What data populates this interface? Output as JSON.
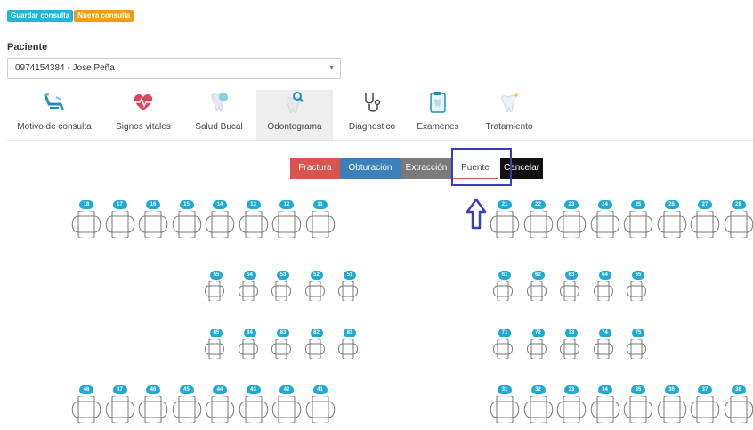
{
  "toolbar": {
    "save_label": "Guardar consulta",
    "new_label": "Nueva consulta"
  },
  "patient": {
    "label": "Paciente",
    "value": "0974154384 - Jose Peña"
  },
  "tabs": [
    {
      "label": "Motivo de consulta",
      "icon": "dental-chair-icon"
    },
    {
      "label": "Signos vitales",
      "icon": "heartbeat-icon"
    },
    {
      "label": "Salud Bucal",
      "icon": "tooth-shield-icon"
    },
    {
      "label": "Odontograma",
      "icon": "tooth-search-icon",
      "active": true
    },
    {
      "label": "Diagnostico",
      "icon": "stethoscope-icon"
    },
    {
      "label": "Examenes",
      "icon": "clipboard-tooth-icon"
    },
    {
      "label": "Tratamiento",
      "icon": "tooth-sparkle-icon"
    }
  ],
  "actions": {
    "fractura": "Fractura",
    "obturacion": "Obturación",
    "extraccion": "Extracción",
    "puente": "Puente",
    "cancelar": "Cancelar"
  },
  "teeth": {
    "upper_right": [
      "18",
      "17",
      "16",
      "15",
      "14",
      "13",
      "12",
      "11"
    ],
    "upper_left": [
      "21",
      "22",
      "23",
      "24",
      "25",
      "26",
      "27",
      "28"
    ],
    "primary_upper_right": [
      "55",
      "54",
      "53",
      "52",
      "51"
    ],
    "primary_upper_left": [
      "61",
      "62",
      "63",
      "64",
      "65"
    ],
    "primary_lower_right": [
      "85",
      "84",
      "83",
      "82",
      "81"
    ],
    "primary_lower_left": [
      "71",
      "72",
      "73",
      "74",
      "75"
    ],
    "lower_right": [
      "48",
      "47",
      "46",
      "45",
      "44",
      "43",
      "42",
      "41"
    ],
    "lower_left": [
      "31",
      "32",
      "33",
      "34",
      "35",
      "36",
      "37",
      "38"
    ]
  },
  "colors": {
    "accent": "#22b4dd",
    "fractura": "#d9534f",
    "obturacion": "#3b80b8",
    "extraccion": "#7a7a7a",
    "highlight": "#3b3bbf"
  }
}
